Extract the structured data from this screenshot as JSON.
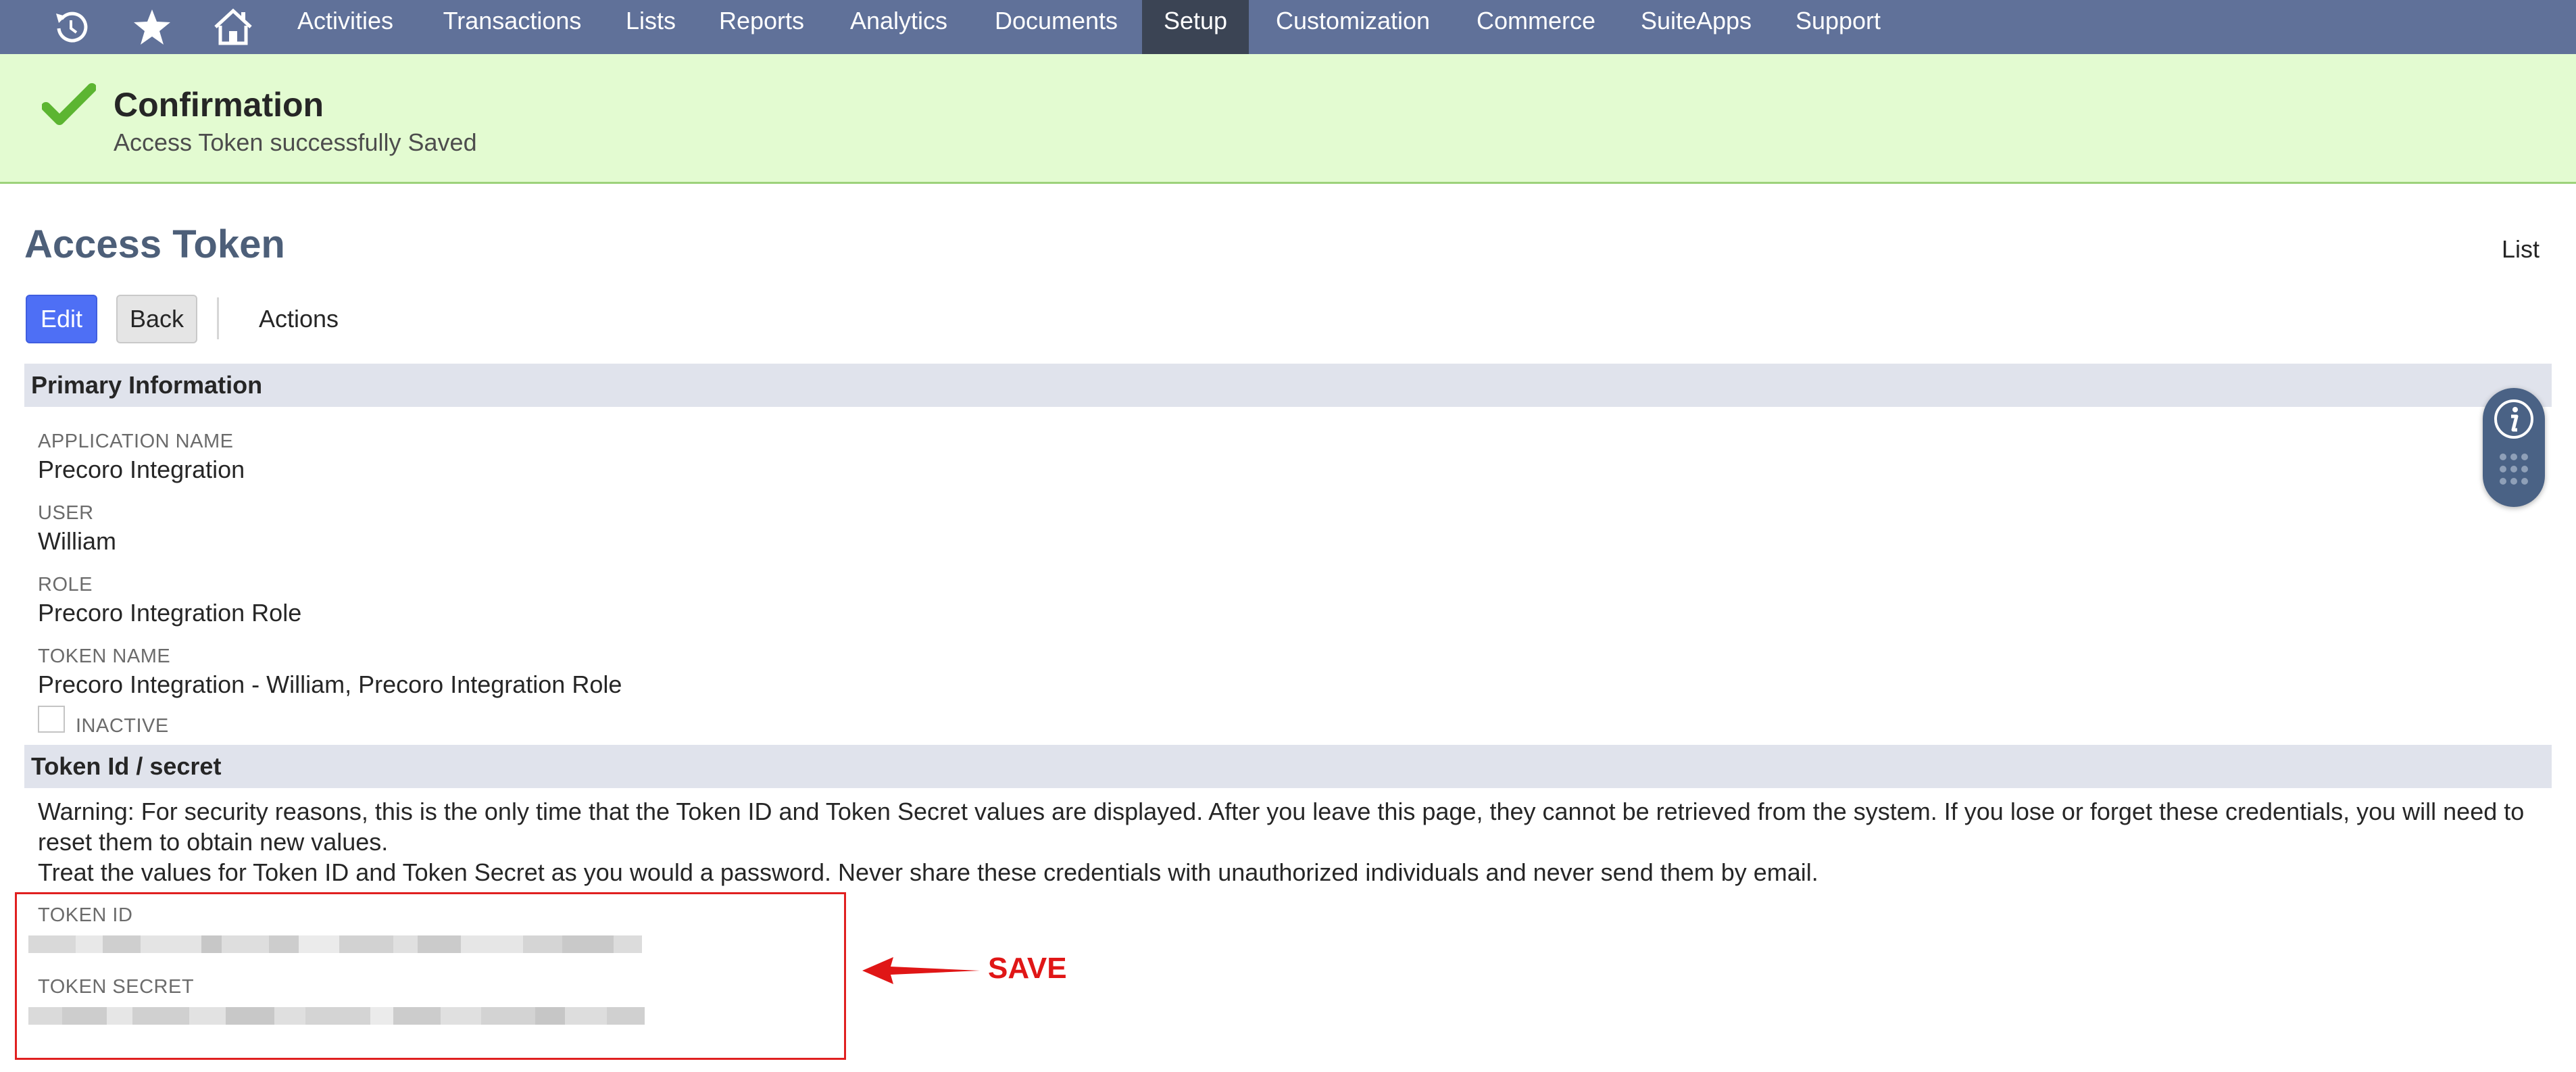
{
  "nav": {
    "icons": [
      "recent-icon",
      "star-icon",
      "home-icon"
    ],
    "items": [
      "Activities",
      "Transactions",
      "Lists",
      "Reports",
      "Analytics",
      "Documents",
      "Setup",
      "Customization",
      "Commerce",
      "SuiteApps",
      "Support"
    ],
    "active": "Setup"
  },
  "banner": {
    "title": "Confirmation",
    "message": "Access Token successfully Saved"
  },
  "page": {
    "title": "Access Token",
    "list_link": "List"
  },
  "toolbar": {
    "edit": "Edit",
    "back": "Back",
    "actions": "Actions"
  },
  "primary": {
    "header": "Primary Information",
    "application_name_label": "APPLICATION NAME",
    "application_name": "Precoro Integration",
    "user_label": "USER",
    "user": "William",
    "role_label": "ROLE",
    "role": "Precoro Integration Role",
    "token_name_label": "TOKEN NAME",
    "token_name": "Precoro Integration - William, Precoro Integration Role",
    "inactive_label": "INACTIVE",
    "inactive_checked": false
  },
  "token": {
    "header": "Token Id / secret",
    "warning_1": "Warning: For security reasons, this is the only time that the Token ID and Token Secret values are displayed. After you leave this page, they cannot be retrieved from the system. If you lose or forget these credentials, you will need to reset them to obtain new values.",
    "warning_2": "Treat the values for Token ID and Token Secret as you would a password. Never share these credentials with unauthorized individuals and never send them by email.",
    "id_label": "TOKEN ID",
    "secret_label": "TOKEN SECRET"
  },
  "annotation": {
    "label": "SAVE",
    "color": "#e01616"
  },
  "colors": {
    "nav_bg": "#607199",
    "nav_active": "#3b4454",
    "banner_bg": "#e3fbd1",
    "check": "#5cb531",
    "edit_button": "#4e6ff5",
    "title": "#4d5f79",
    "section_bg": "#e0e3ec"
  }
}
